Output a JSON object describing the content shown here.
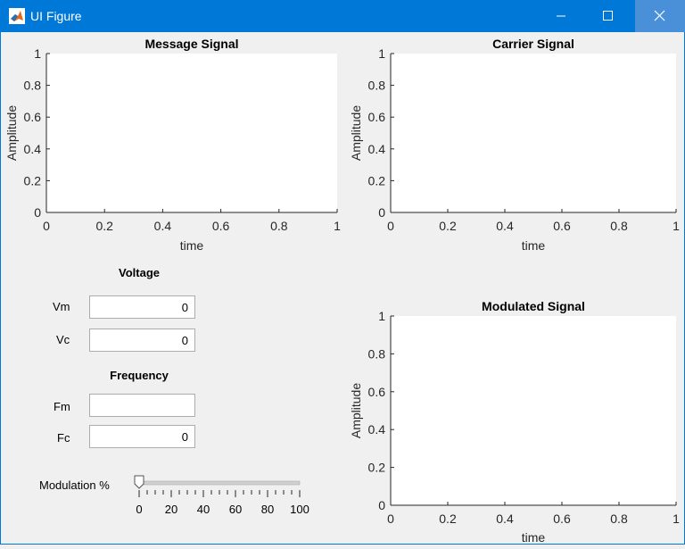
{
  "window": {
    "title": "UI Figure"
  },
  "plots": {
    "message": {
      "title": "Message Signal",
      "xlabel": "time",
      "ylabel": "Amplitude",
      "xticks": [
        "0",
        "0.2",
        "0.4",
        "0.6",
        "0.8",
        "1"
      ],
      "yticks": [
        "0",
        "0.2",
        "0.4",
        "0.6",
        "0.8",
        "1"
      ]
    },
    "carrier": {
      "title": "Carrier Signal",
      "xlabel": "time",
      "ylabel": "Amplitude",
      "xticks": [
        "0",
        "0.2",
        "0.4",
        "0.6",
        "0.8",
        "1"
      ],
      "yticks": [
        "0",
        "0.2",
        "0.4",
        "0.6",
        "0.8",
        "1"
      ]
    },
    "modulated": {
      "title": "Modulated Signal",
      "xlabel": "time",
      "ylabel": "Amplitude",
      "xticks": [
        "0",
        "0.2",
        "0.4",
        "0.6",
        "0.8",
        "1"
      ],
      "yticks": [
        "0",
        "0.2",
        "0.4",
        "0.6",
        "0.8",
        "1"
      ]
    }
  },
  "voltage": {
    "heading": "Voltage",
    "vm_label": "Vm",
    "vm_value": "0",
    "vc_label": "Vc",
    "vc_value": "0"
  },
  "frequency": {
    "heading": "Frequency",
    "fm_label": "Fm",
    "fm_value": "",
    "fc_label": "Fc",
    "fc_value": "0"
  },
  "modulation": {
    "label": "Modulation %",
    "value": 0,
    "ticks": [
      "0",
      "20",
      "40",
      "60",
      "80",
      "100"
    ]
  }
}
